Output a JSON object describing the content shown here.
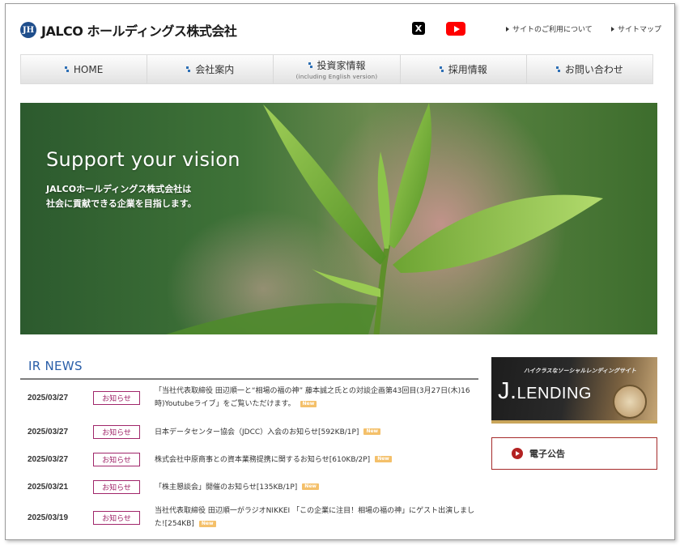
{
  "header": {
    "logo_mark": "JH",
    "logo_text": "JALCO ホールディングス株式会社",
    "x_label": "X",
    "links": [
      "サイトのご利用について",
      "サイトマップ"
    ]
  },
  "nav": [
    {
      "label": "HOME",
      "sub": ""
    },
    {
      "label": "会社案内",
      "sub": ""
    },
    {
      "label": "投資家情報",
      "sub": "(including English version)"
    },
    {
      "label": "採用情報",
      "sub": ""
    },
    {
      "label": "お問い合わせ",
      "sub": ""
    }
  ],
  "hero": {
    "title": "Support your vision",
    "line1": "JALCOホールディングス株式会社は",
    "line2": "社会に貢献できる企業を目指します。"
  },
  "news": {
    "title": "IR NEWS",
    "new_label": "New",
    "items": [
      {
        "date": "2025/03/27",
        "badge": "お知らせ",
        "text": "「当社代表取締役 田辺順一と“相場の福の神” 藤本誠之氏との対談企画第43回目(3月27日(木)16時)Youtubeライブ」をご覧いただけます。"
      },
      {
        "date": "2025/03/27",
        "badge": "お知らせ",
        "text": "日本データセンター協会（JDCC）入会のお知らせ[592KB/1P]"
      },
      {
        "date": "2025/03/27",
        "badge": "お知らせ",
        "text": "株式会社中原商事との資本業務提携に関するお知らせ[610KB/2P]"
      },
      {
        "date": "2025/03/21",
        "badge": "お知らせ",
        "text": "「株主懇談会」開催のお知らせ[135KB/1P]"
      },
      {
        "date": "2025/03/19",
        "badge": "お知らせ",
        "text": "当社代表取締役 田辺順一がラジオNIKKEI 「この企業に注目！相場の福の神」にゲスト出演しました![254KB]"
      }
    ]
  },
  "side": {
    "jlending_sub": "ハイクラスなソーシャルレンディングサイト",
    "jlending_logo_j": "J.",
    "jlending_logo_rest": "LENDING",
    "ekoukoku": "電子公告"
  },
  "colors": {
    "accent_blue": "#2a5ea8",
    "badge": "#a0266a",
    "youtube": "#ff0000"
  }
}
